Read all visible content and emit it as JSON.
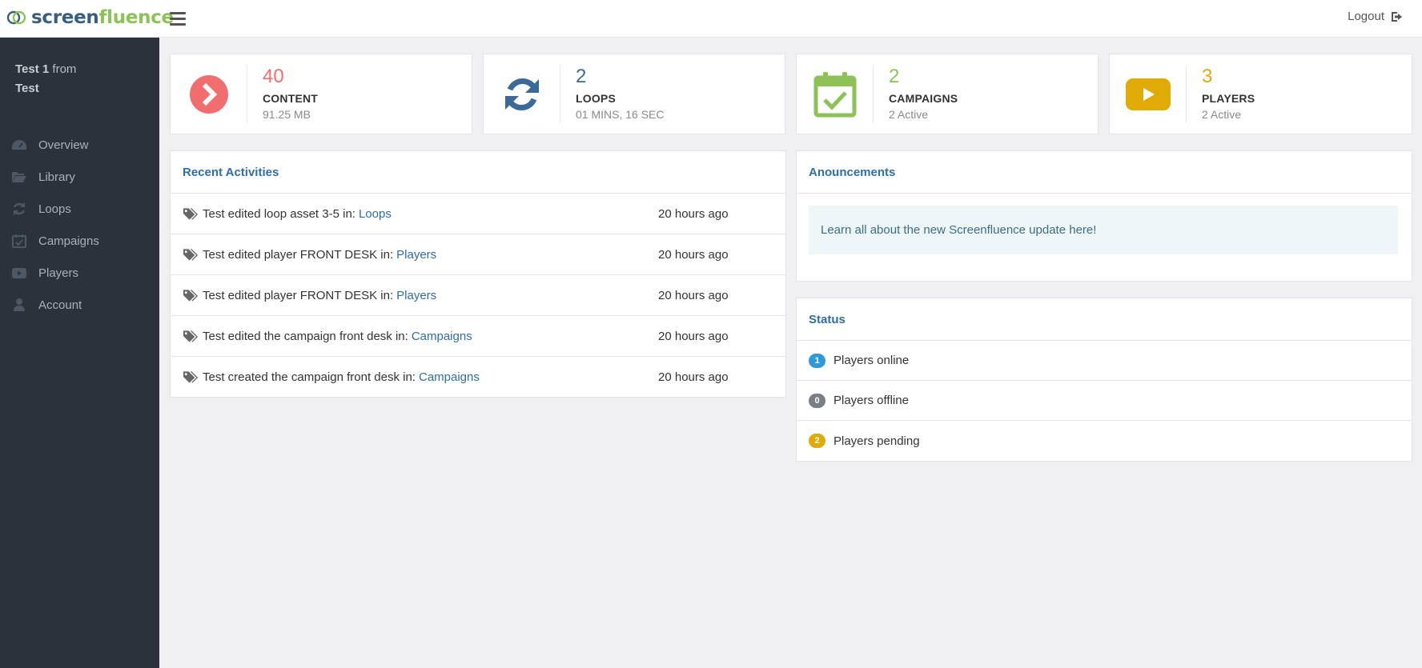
{
  "brand": {
    "part1": "screen",
    "part2": "fluence"
  },
  "header": {
    "logout_label": "Logout"
  },
  "user": {
    "name": "Test 1",
    "from_word": "from",
    "org": "Test"
  },
  "sidebar": {
    "items": [
      {
        "label": "Overview",
        "icon": "dashboard-icon"
      },
      {
        "label": "Library",
        "icon": "folder-open-icon"
      },
      {
        "label": "Loops",
        "icon": "refresh-icon"
      },
      {
        "label": "Campaigns",
        "icon": "calendar-check-icon"
      },
      {
        "label": "Players",
        "icon": "youtube-play-icon"
      },
      {
        "label": "Account",
        "icon": "user-icon"
      }
    ]
  },
  "stats": [
    {
      "value": "40",
      "label": "CONTENT",
      "sub": "91.25 MB",
      "color": "#f26d6d",
      "icon": "chevron-circle-right-icon"
    },
    {
      "value": "2",
      "label": "LOOPS",
      "sub": "01 MINS, 16 SEC",
      "color": "#3b6a99",
      "icon": "refresh-icon"
    },
    {
      "value": "2",
      "label": "CAMPAIGNS",
      "sub": "2 Active",
      "color": "#8cc256",
      "icon": "calendar-check-icon"
    },
    {
      "value": "3",
      "label": "PLAYERS",
      "sub": "2 Active",
      "color": "#e0ab06",
      "icon": "youtube-play-icon"
    }
  ],
  "activities": {
    "title": "Recent Activities",
    "rows": [
      {
        "text": "Test edited loop asset 3-5 in:",
        "link": "Loops",
        "time": "20 hours ago"
      },
      {
        "text": "Test edited player FRONT DESK in:",
        "link": "Players",
        "time": "20 hours ago"
      },
      {
        "text": "Test edited player FRONT DESK in:",
        "link": "Players",
        "time": "20 hours ago"
      },
      {
        "text": "Test edited the campaign front desk in:",
        "link": "Campaigns",
        "time": "20 hours ago"
      },
      {
        "text": "Test created the campaign front desk in:",
        "link": "Campaigns",
        "time": "20 hours ago"
      }
    ]
  },
  "announcements": {
    "title": "Anouncements",
    "message": "Learn all about the new Screenfluence update here!"
  },
  "status": {
    "title": "Status",
    "rows": [
      {
        "count": "1",
        "label": "Players online",
        "color": "#2e9bd6"
      },
      {
        "count": "0",
        "label": "Players offline",
        "color": "#7a7f85"
      },
      {
        "count": "2",
        "label": "Players pending",
        "color": "#e0ab06"
      }
    ]
  }
}
